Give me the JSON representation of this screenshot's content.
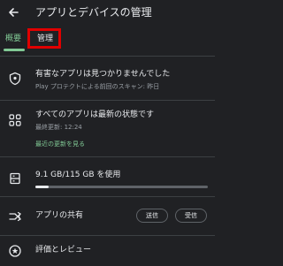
{
  "header": {
    "title": "アプリとデバイスの管理"
  },
  "tabs": [
    {
      "label": "概要"
    },
    {
      "label": "管理"
    }
  ],
  "sections": {
    "protect": {
      "title": "有害なアプリは見つかりませんでした",
      "subtitle": "Play プロテクトによる前回のスキャン: 昨日"
    },
    "updates": {
      "title": "すべてのアプリは最新の状態です",
      "subtitle": "最終更新: 12:24",
      "link": "最近の更新を見る"
    },
    "storage": {
      "label": "9.1 GB/115 GB を使用",
      "used_gb": 9.1,
      "total_gb": 115
    },
    "sharing": {
      "title": "アプリの共有",
      "send_label": "送信",
      "receive_label": "受信"
    },
    "reviews": {
      "title": "評価とレビュー"
    }
  },
  "colors": {
    "background": "#202124",
    "accent": "#81c995",
    "highlight_box": "#e00000",
    "text": "#e8eaed",
    "secondary_text": "#9aa0a6"
  },
  "icons": [
    "arrow-back-icon",
    "shield-icon",
    "apps-grid-icon",
    "storage-icon",
    "share-icon",
    "star-icon"
  ]
}
